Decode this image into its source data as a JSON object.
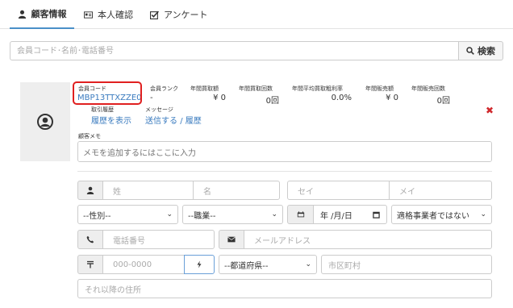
{
  "tabs": [
    {
      "label": "顧客情報"
    },
    {
      "label": "本人確認"
    },
    {
      "label": "アンケート"
    }
  ],
  "search": {
    "placeholder": "会員コード･名前･電話番号",
    "button_label": "検索"
  },
  "stats": {
    "member_code_label": "会員コード",
    "member_code_value": "MBP13TTXZZE0",
    "member_rank_label": "会員ランク",
    "member_rank_value": "-",
    "annual_purchase_amount_label": "年間買取額",
    "annual_purchase_amount_value": "¥ 0",
    "annual_purchase_count_label": "年間買取回数",
    "annual_purchase_count_value": "0回",
    "avg_margin_label": "年間平均買取粗利率",
    "avg_margin_value": "0.0%",
    "annual_sales_amount_label": "年間販売額",
    "annual_sales_amount_value": "¥ 0",
    "annual_sales_count_label": "年間販売回数",
    "annual_sales_count_value": "0回",
    "history_label": "取引履歴",
    "history_link": "履歴を表示",
    "message_label": "メッセージ",
    "message_send": "送信する",
    "message_sep": "/",
    "message_history": "履歴"
  },
  "memo": {
    "label": "顧客メモ",
    "placeholder": "メモを追加するにはここに入力"
  },
  "form": {
    "last_name": "姓",
    "first_name": "名",
    "last_kana": "セイ",
    "first_kana": "メイ",
    "gender": "--性別--",
    "occupation": "--職業--",
    "birthdate": "年 /月/日",
    "invoice": "適格事業者ではない",
    "phone": "電話番号",
    "email": "メールアドレス",
    "postal": "000-0000",
    "prefecture": "--都道府県--",
    "city": "市区町村",
    "address_rest": "それ以降の住所"
  },
  "colors": {
    "accent": "#4a90c8",
    "link": "#3a7bbf",
    "highlight": "#e02020",
    "close": "#d0282c"
  }
}
